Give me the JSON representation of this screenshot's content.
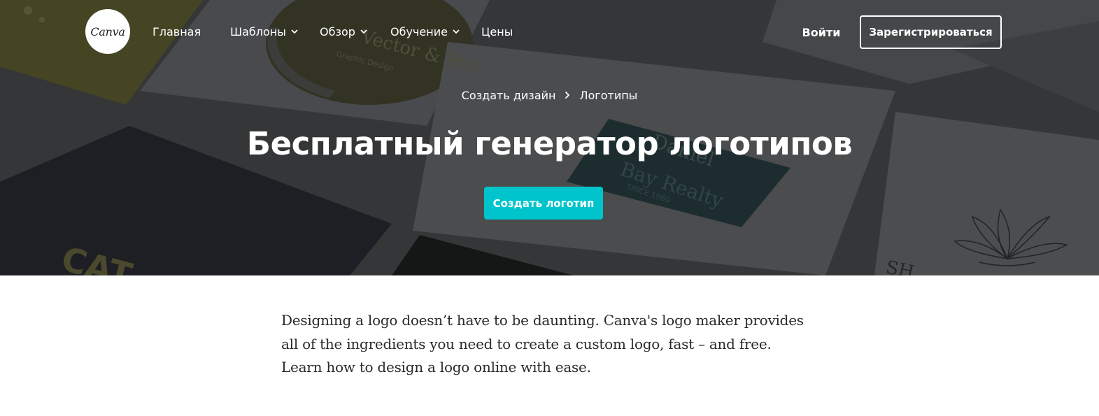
{
  "brand": {
    "logo_text": "Canva"
  },
  "nav": {
    "items": [
      {
        "label": "Главная",
        "has_dropdown": false
      },
      {
        "label": "Шаблоны",
        "has_dropdown": true
      },
      {
        "label": "Обзор",
        "has_dropdown": true
      },
      {
        "label": "Обучение",
        "has_dropdown": true
      },
      {
        "label": "Цены",
        "has_dropdown": false
      }
    ],
    "login_label": "Войти",
    "signup_label": "Зарегистрироваться"
  },
  "breadcrumb": {
    "items": [
      "Создать дизайн",
      "Логотипы"
    ],
    "separator_icon": "chevron-right-icon"
  },
  "hero": {
    "title": "Бесплатный генератор логотипов",
    "cta_label": "Создать логотип",
    "background_texts": [
      "Vector & Pen",
      "Graphic Design",
      "Daniel",
      "Bay Realty",
      "SINCE 1960",
      "CAT",
      "SH"
    ]
  },
  "intro": {
    "lines": [
      "Designing a logo doesn’t have to be daunting. Canva's logo maker provides",
      "all of the ingredients you need to create a custom logo, fast – and free.",
      "Learn how to design a logo online with ease."
    ]
  },
  "colors": {
    "accent": "#00c4cc",
    "hero_overlay": "#3f4043",
    "text_dark": "#2b2b2b",
    "white": "#ffffff"
  }
}
